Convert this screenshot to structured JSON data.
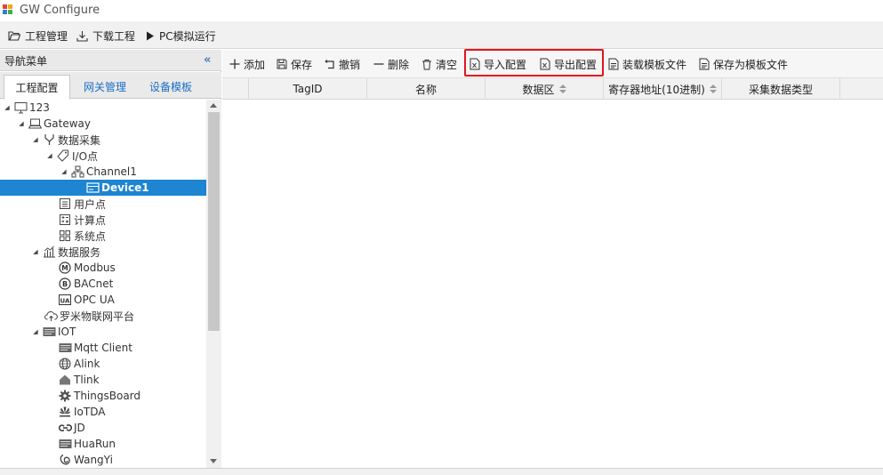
{
  "app": {
    "title": "GW Configure"
  },
  "menubar": {
    "items": [
      {
        "label": "工程管理",
        "icon": "folder-open-icon"
      },
      {
        "label": "下载工程",
        "icon": "download-icon"
      },
      {
        "label": "PC模拟运行",
        "icon": "play-icon"
      }
    ]
  },
  "sidebar": {
    "title": "导航菜单",
    "collapse_icon": "double-chevron-left-icon",
    "tabs": [
      {
        "label": "工程配置",
        "active": true
      },
      {
        "label": "网关管理",
        "active": false
      },
      {
        "label": "设备模板",
        "active": false
      }
    ],
    "tree": [
      {
        "label": "123",
        "icon": "monitor-icon",
        "level": 0,
        "expanded": true
      },
      {
        "label": "Gateway",
        "icon": "laptop-icon",
        "level": 1,
        "expanded": true
      },
      {
        "label": "数据采集",
        "icon": "fork-icon",
        "level": 2,
        "expanded": true
      },
      {
        "label": "I/O点",
        "icon": "tag-icon",
        "level": 3,
        "expanded": true
      },
      {
        "label": "Channel1",
        "icon": "network-icon",
        "level": 4,
        "expanded": true
      },
      {
        "label": "Device1",
        "icon": "device-icon",
        "level": 5,
        "selected": true
      },
      {
        "label": "用户点",
        "icon": "list-icon",
        "level": 3
      },
      {
        "label": "计算点",
        "icon": "calculator-icon",
        "level": 3
      },
      {
        "label": "系统点",
        "icon": "grid-icon",
        "level": 3
      },
      {
        "label": "数据服务",
        "icon": "chart-icon",
        "level": 2,
        "expanded": true
      },
      {
        "label": "Modbus",
        "icon": "modbus-icon",
        "level": 3
      },
      {
        "label": "BACnet",
        "icon": "bacnet-icon",
        "level": 3
      },
      {
        "label": "OPC UA",
        "icon": "opcua-icon",
        "level": 3
      },
      {
        "label": "罗米物联网平台",
        "icon": "cloud-upload-icon",
        "level": 2
      },
      {
        "label": "IOT",
        "icon": "server-icon",
        "level": 2,
        "expanded": true
      },
      {
        "label": "Mqtt Client",
        "icon": "server-icon",
        "level": 3
      },
      {
        "label": "Alink",
        "icon": "globe-icon",
        "level": 3
      },
      {
        "label": "Tlink",
        "icon": "house-icon",
        "level": 3
      },
      {
        "label": "ThingsBoard",
        "icon": "cog-icon",
        "level": 3
      },
      {
        "label": "IoTDA",
        "icon": "huawei-icon",
        "level": 3
      },
      {
        "label": "JD",
        "icon": "link-icon",
        "level": 3
      },
      {
        "label": "HuaRun",
        "icon": "server-icon",
        "level": 3
      },
      {
        "label": "WangYi",
        "icon": "wangyi-icon",
        "level": 3
      }
    ]
  },
  "toolbar": {
    "buttons": [
      {
        "label": "添加",
        "icon": "plus-icon"
      },
      {
        "label": "保存",
        "icon": "save-icon"
      },
      {
        "label": "撤销",
        "icon": "undo-icon"
      },
      {
        "label": "删除",
        "icon": "minus-icon"
      },
      {
        "label": "清空",
        "icon": "trash-icon"
      },
      {
        "label": "导入配置",
        "icon": "excel-icon"
      },
      {
        "label": "导出配置",
        "icon": "excel-icon"
      },
      {
        "label": "装载模板文件",
        "icon": "file-icon"
      },
      {
        "label": "保存为模板文件",
        "icon": "file-icon"
      }
    ],
    "highlight_color": "#e0161c"
  },
  "grid": {
    "columns": [
      {
        "label": ""
      },
      {
        "label": "TagID"
      },
      {
        "label": "名称"
      },
      {
        "label": "数据区",
        "sortable": true
      },
      {
        "label": "寄存器地址(10进制)",
        "sortable": true
      },
      {
        "label": "采集数据类型"
      }
    ],
    "rows": []
  },
  "colors": {
    "selection": "#1d85d1",
    "link": "#1a6fc4",
    "accent": "#3a7fc1"
  }
}
